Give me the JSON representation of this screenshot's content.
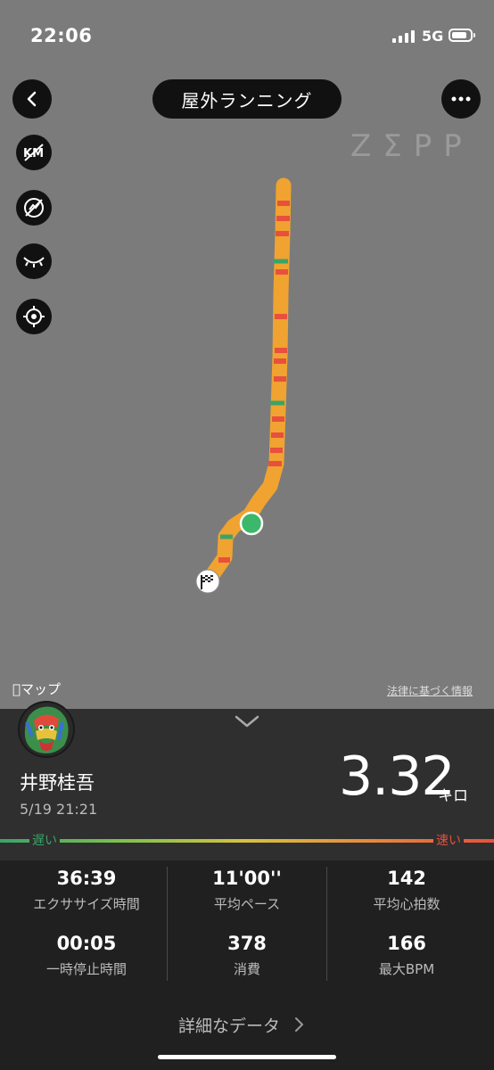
{
  "status_bar": {
    "time": "22:06",
    "network": "5G"
  },
  "header": {
    "title": "屋外ランニング"
  },
  "brand": {
    "logo_text": "ZΣPP"
  },
  "map": {
    "provider_label": "マップ",
    "legal_link": "法律に基づく情報",
    "controls": [
      "km-markers-icon",
      "hide-speed-icon",
      "eye-closed-icon",
      "locate-icon"
    ]
  },
  "user": {
    "name": "井野桂吾",
    "date": "5/19 21:21"
  },
  "summary": {
    "distance": "3.32",
    "unit": "キロ"
  },
  "pace_scale": {
    "slow": "遅い",
    "fast": "速い"
  },
  "stats": [
    {
      "value": "36:39",
      "label": "エクササイズ時間"
    },
    {
      "value": "11'00''",
      "label": "平均ペース"
    },
    {
      "value": "142",
      "label": "平均心拍数"
    },
    {
      "value": "00:05",
      "label": "一時停止時間"
    },
    {
      "value": "378",
      "label": "消費"
    },
    {
      "value": "166",
      "label": "最大BPM"
    }
  ],
  "footer": {
    "detail_link": "詳細なデータ"
  },
  "colors": {
    "route": "#f0a330",
    "fast": "#e8503d",
    "slow": "#3aa368",
    "start": "#3bb86a"
  }
}
